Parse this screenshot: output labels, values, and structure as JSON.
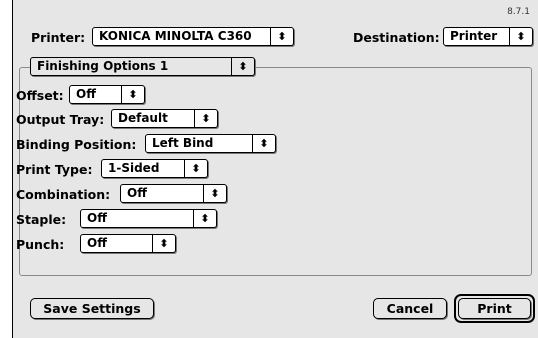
{
  "version": "8.7.1",
  "printer": {
    "label": "Printer:",
    "value": "KONICA MINOLTA C360"
  },
  "destination": {
    "label": "Destination:",
    "value": "Printer"
  },
  "panel": {
    "value": "Finishing Options 1"
  },
  "options": [
    {
      "label": "Offset:",
      "value": "Off"
    },
    {
      "label": "Output Tray:",
      "value": "Default"
    },
    {
      "label": "Binding Position:",
      "value": "Left Bind"
    },
    {
      "label": "Print Type:",
      "value": "1-Sided"
    },
    {
      "label": "Combination:",
      "value": "Off"
    },
    {
      "label": "Staple:",
      "value": "Off"
    },
    {
      "label": "Punch:",
      "value": "Off"
    }
  ],
  "buttons": {
    "save": "Save Settings",
    "cancel": "Cancel",
    "print": "Print"
  },
  "arrow_glyph": "⬍"
}
